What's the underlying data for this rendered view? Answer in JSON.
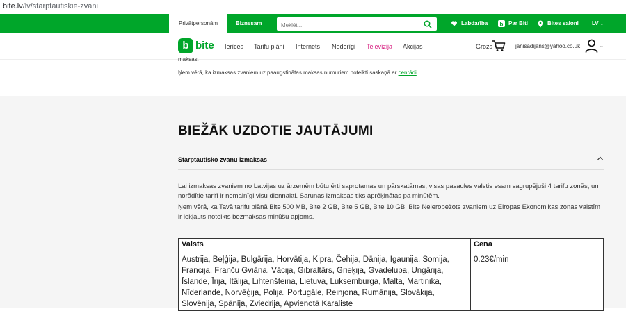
{
  "browser": {
    "url_host": "bite.lv",
    "url_path": "/lv/starptautiskie-zvani"
  },
  "topbar": {
    "tabs": [
      "Privātpersonām",
      "Biznesam"
    ],
    "search_placeholder": "Meklēt...",
    "links": [
      "Labdarība",
      "Par Biti",
      "Bites saloni"
    ],
    "language": "LV"
  },
  "navbar": {
    "logo_letter": "b",
    "logo_text": "bite",
    "items": [
      "Ierīces",
      "Tarifu plāni",
      "Internets",
      "Noderīgi",
      "Televīzija",
      "Akcijas"
    ],
    "cart_label": "Grozs",
    "user_email": "janisadijans@yahoo.co.uk"
  },
  "notes": {
    "line1": "maksas.",
    "line2_prefix": "Ņem vērā, ka izmaksas zvaniem uz paaugstinātas maksas numuriem noteikti saskaņā ar ",
    "line2_link": "cenrādi",
    "line2_suffix": "."
  },
  "faq": {
    "title": "BIEŽĀK UZDOTIE JAUTĀJUMI",
    "accordion_title": "Starptautisko zvanu izmaksas",
    "paragraph1": "Lai izmaksas zvaniem no Latvijas uz ārzemēm būtu ērti saprotamas un pārskatāmas, visas pasaules valstis esam sagrupējuši 4 tarifu zonās, un norādītie tarifi ir nemainīgi visu diennakti. Sarunas izmaksas tiks aprēķinātas pa minūtēm.",
    "paragraph2": "Ņem vērā, ka Tavā tarifu plānā Bite 500 MB, Bite 2 GB, Bite 5 GB, Bite 10 GB, Bite Neierobežots zvaniem uz Eiropas Ekonomikas zonas valstīm ir iekļauts noteikts bezmaksas minūšu apjoms.",
    "table": {
      "headers": [
        "Valsts",
        "Cena"
      ],
      "rows": [
        {
          "countries": "Austrija, Beļģija, Bulgārija, Horvātija, Kipra, Čehija, Dānija, Igaunija, Somija, Francija, Franču Gviāna, Vācija, Gibraltārs, Grieķija, Gvadelupa, Ungārija, Īslande, Īrija, Itālija, Lihtenšteina, Lietuva, Luksemburga, Malta, Martinika, Nīderlande, Norvēģija, Polija, Portugāle, Reinjona, Rumānija, Slovākija, Slovēnija, Spānija, Zviedrija, Apvienotā Karaliste",
          "price": "0.23€/min"
        }
      ]
    }
  },
  "colors": {
    "brand_green": "#00a62a",
    "tv_pink": "#d61c7f"
  }
}
